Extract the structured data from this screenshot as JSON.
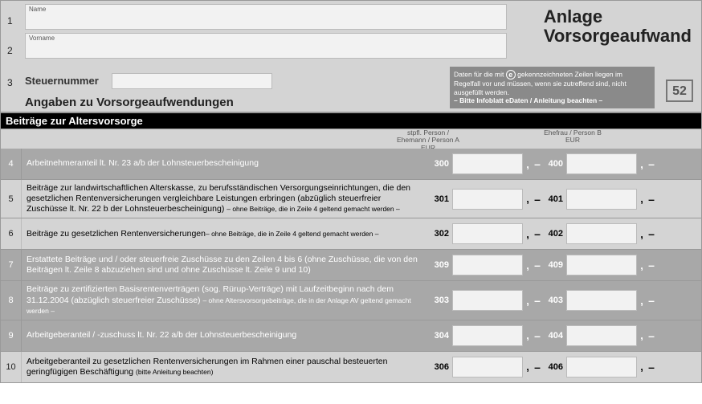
{
  "header": {
    "name_label": "Name",
    "vorname_label": "Vorname",
    "steuernummer_label": "Steuernummer",
    "title_line1": "Anlage",
    "title_line2": "Vorsorgeaufwand",
    "heading2": "Angaben zu Vorsorgeaufwendungen",
    "page_number": "52",
    "note_part1": "Daten für die mit ",
    "note_e": "e",
    "note_part2": " gekennzeichneten Zeilen liegen im Regelfall vor und müssen, wenn sie zutreffend sind, nicht ausgefüllt werden.",
    "note_part3": "– Bitte Infoblatt eDaten / Anleitung beachten –"
  },
  "col_headers": {
    "colA_line1": "stpfl. Person /",
    "colA_line2": "Ehemann / Person A",
    "colA_line3": "EUR",
    "colB_line1": "Ehefrau / Person B",
    "colB_line2": "EUR"
  },
  "section_title": "Beiträge zur Altersvorsorge",
  "rows": [
    {
      "n": "4",
      "shade": true,
      "e": true,
      "text": "Arbeitnehmeranteil lt. Nr. 23 a/b der Lohnsteuerbescheinigung",
      "codeA": "300",
      "codeB": "400"
    },
    {
      "n": "5",
      "shade": false,
      "e": false,
      "text": "Beiträge zur landwirtschaftlichen Alterskasse, zu berufsständischen Versorgungseinrichtungen, die den gesetzlichen Rentenversicherungen vergleichbare Leistungen erbringen (abzüglich steuerfreier Zuschüsse lt. Nr. 22 b der Lohnsteuerbescheinigung) ",
      "text_small": "– ohne Beiträge, die in Zeile 4 geltend gemacht werden –",
      "codeA": "301",
      "codeB": "401"
    },
    {
      "n": "6",
      "shade": false,
      "e": false,
      "text": "Beiträge zu gesetzlichen Rentenversicherungen",
      "text_small": "– ohne Beiträge, die in Zeile 4 geltend gemacht werden –",
      "codeA": "302",
      "codeB": "402"
    },
    {
      "n": "7",
      "shade": true,
      "e": true,
      "text": "Erstattete Beiträge und / oder steuerfreie Zuschüsse zu den Zeilen 4 bis 6 (ohne Zuschüsse, die von den Beiträgen lt. Zeile 8 abzuziehen sind und ohne Zuschüsse lt. Zeile 9 und 10)",
      "codeA": "309",
      "codeB": "409"
    },
    {
      "n": "8",
      "shade": true,
      "e": true,
      "text": "Beiträge zu zertifizierten Basisrentenverträgen (sog. Rürup-Verträge) mit Laufzeitbeginn nach dem 31.12.2004 (abzüglich steuerfreier Zuschüsse) ",
      "text_small": "– ohne Altersvorsorgebeiträge, die in der Anlage AV geltend gemacht werden –",
      "codeA": "303",
      "codeB": "403"
    },
    {
      "n": "9",
      "shade": true,
      "e": true,
      "text": "Arbeitgeberanteil / -zuschuss lt. Nr. 22 a/b der Lohnsteuerbescheinigung",
      "codeA": "304",
      "codeB": "404"
    },
    {
      "n": "10",
      "shade": false,
      "e": false,
      "text": "Arbeitgeberanteil zu gesetzlichen Rentenversicherungen im Rahmen einer pauschal besteuerten geringfügigen Beschäftigung ",
      "text_small": "(bitte Anleitung beachten)",
      "codeA": "306",
      "codeB": "406"
    }
  ]
}
